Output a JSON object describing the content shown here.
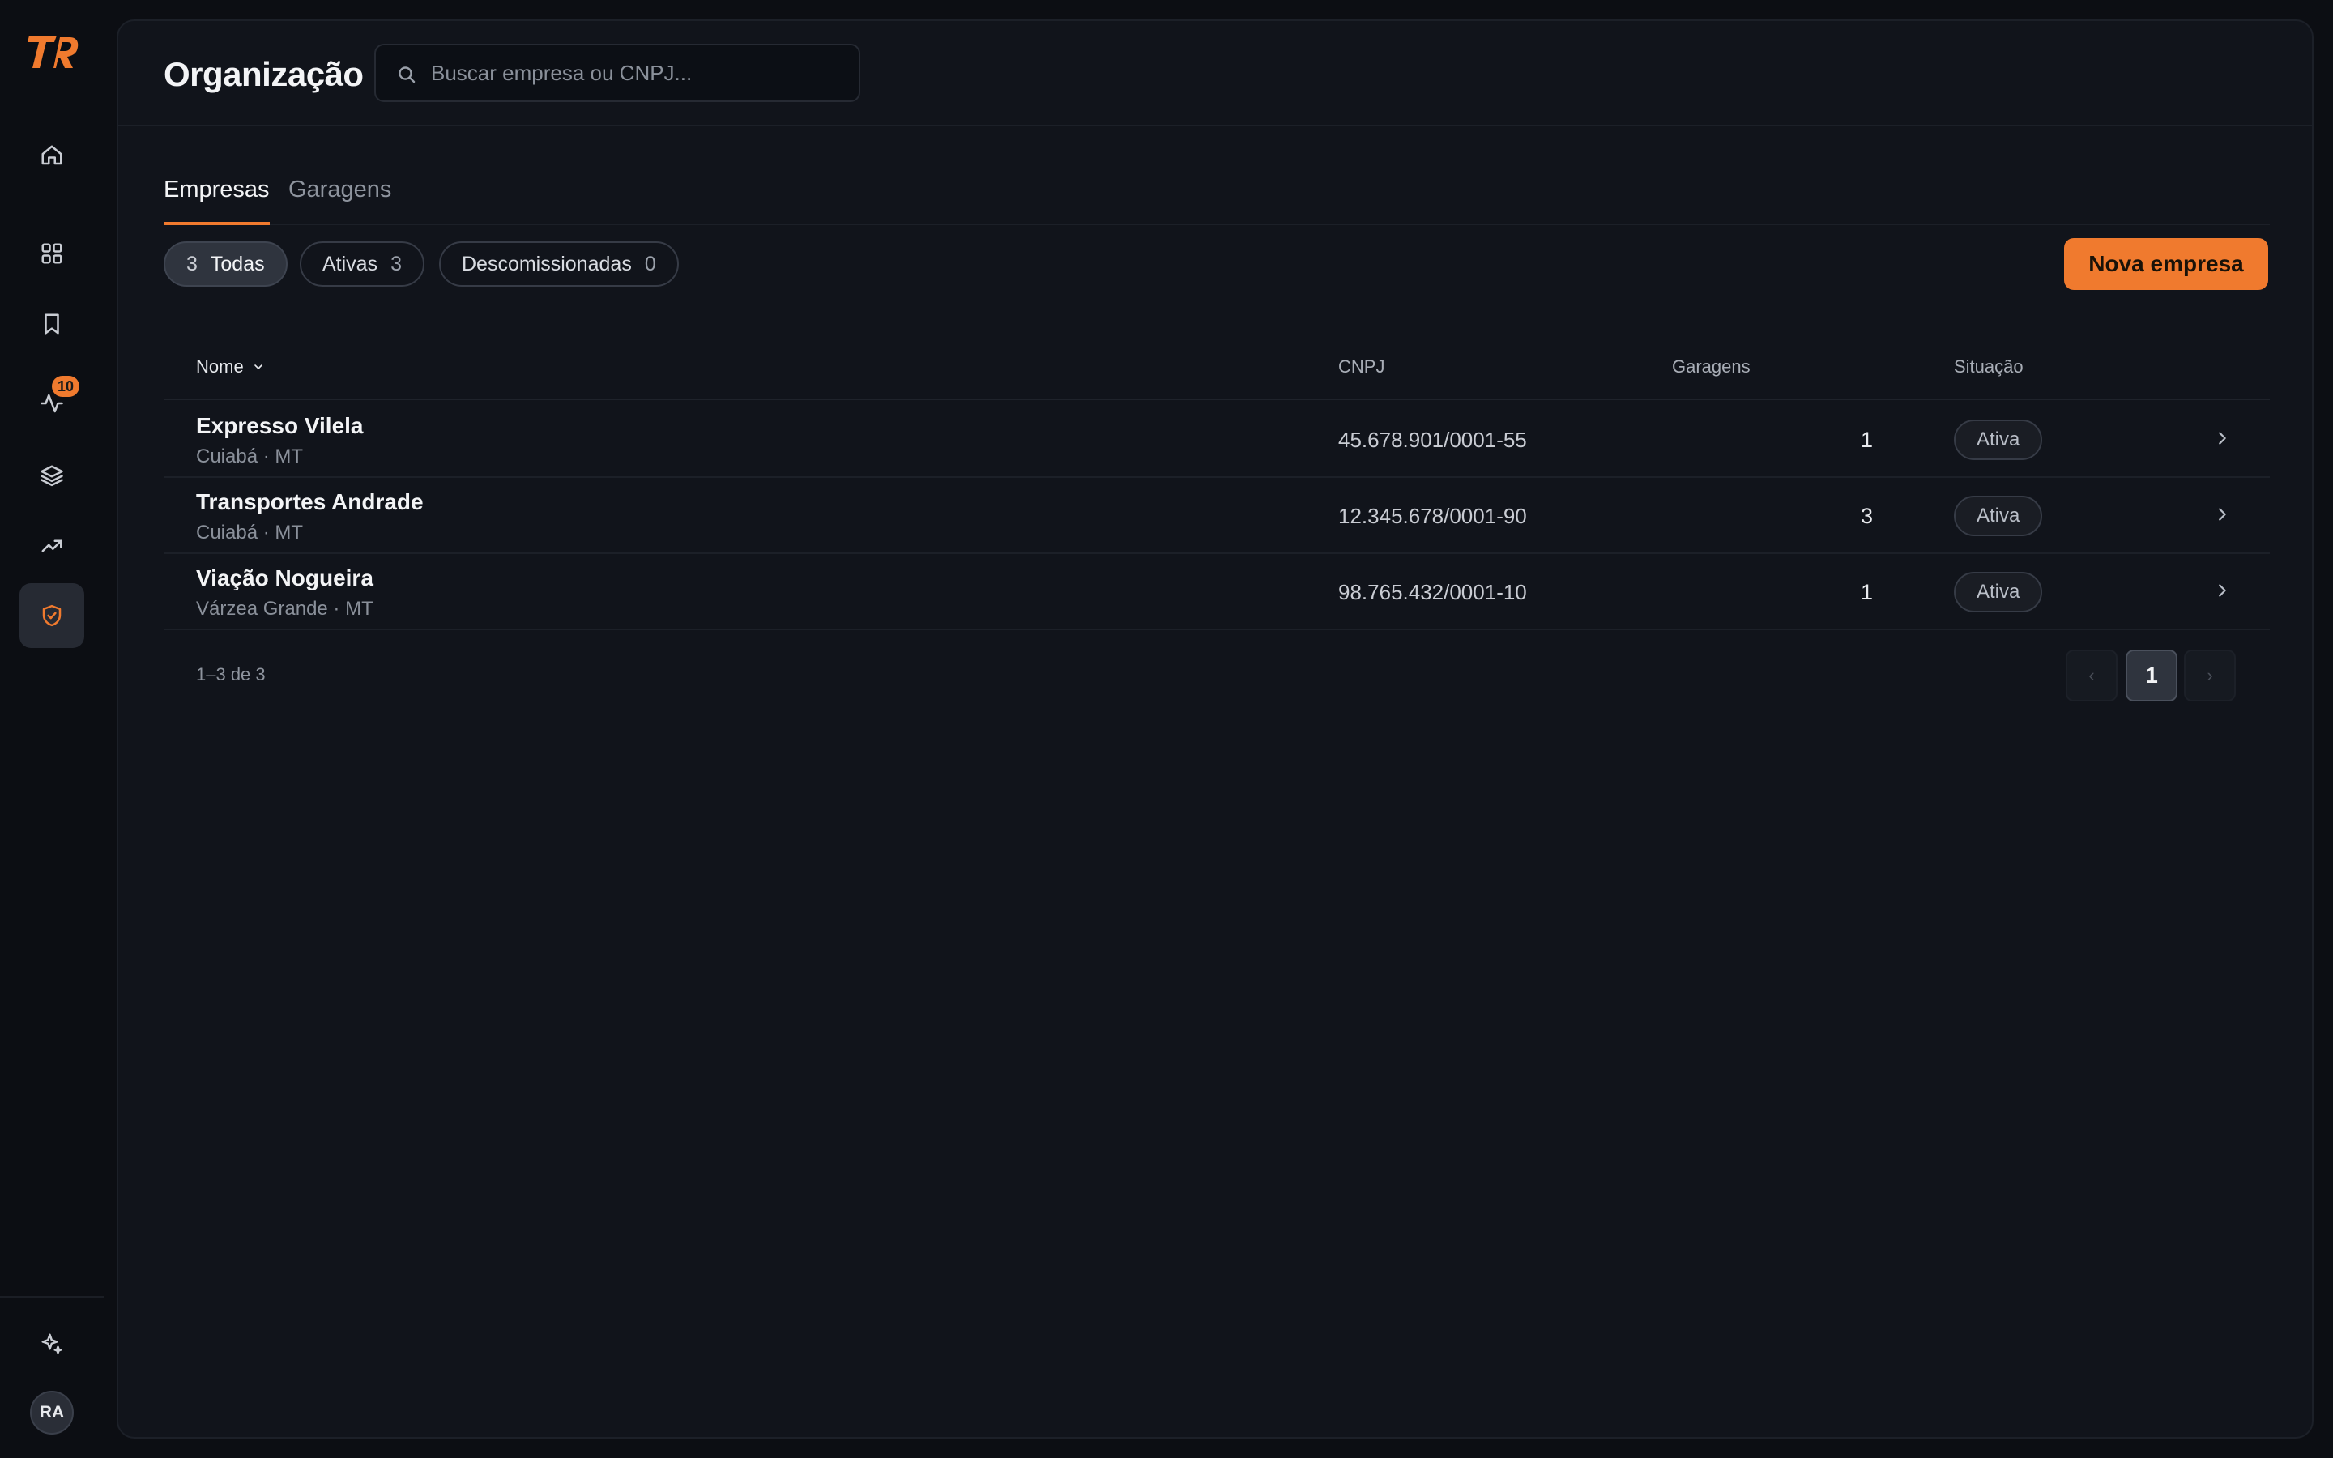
{
  "app": {
    "logo_text": "TR"
  },
  "sidebar": {
    "items": [
      {
        "name": "home",
        "icon": "home-icon"
      },
      {
        "name": "dashboard",
        "icon": "grid-icon"
      },
      {
        "name": "bookmarks",
        "icon": "bookmark-icon"
      },
      {
        "name": "activity",
        "icon": "activity-icon",
        "badge": "10"
      },
      {
        "name": "layers",
        "icon": "layers-icon"
      },
      {
        "name": "trends",
        "icon": "trending-up-icon"
      },
      {
        "name": "organization",
        "icon": "shield-check-icon",
        "active": true
      }
    ],
    "bottom": {
      "sparkle_icon": "sparkles-icon",
      "avatar_initials": "RA"
    }
  },
  "header": {
    "title": "Organização",
    "search_placeholder": "Buscar empresa ou CNPJ..."
  },
  "tabs": [
    {
      "label": "Empresas",
      "active": true
    },
    {
      "label": "Garagens",
      "active": false
    }
  ],
  "filters": [
    {
      "count": "3",
      "label": "Todas",
      "active": true
    },
    {
      "label": "Ativas",
      "count": "3"
    },
    {
      "label": "Descomissionadas",
      "count": "0"
    }
  ],
  "primary_action": "Nova empresa",
  "table": {
    "columns": {
      "nome": "Nome",
      "cnpj": "CNPJ",
      "garagens": "Garagens",
      "situacao": "Situação"
    },
    "rows": [
      {
        "name": "Expresso Vilela",
        "location": "Cuiabá · MT",
        "cnpj": "45.678.901/0001-55",
        "garagens": "1",
        "status": "Ativa"
      },
      {
        "name": "Transportes Andrade",
        "location": "Cuiabá · MT",
        "cnpj": "12.345.678/0001-90",
        "garagens": "3",
        "status": "Ativa"
      },
      {
        "name": "Viação Nogueira",
        "location": "Várzea Grande · MT",
        "cnpj": "98.765.432/0001-10",
        "garagens": "1",
        "status": "Ativa"
      }
    ]
  },
  "pagination": {
    "info": "1–3 de 3",
    "prev": "‹",
    "current": "1",
    "next": "›"
  },
  "colors": {
    "accent": "#f07a2e",
    "background": "#0c0e13",
    "panel": "#11141b"
  }
}
